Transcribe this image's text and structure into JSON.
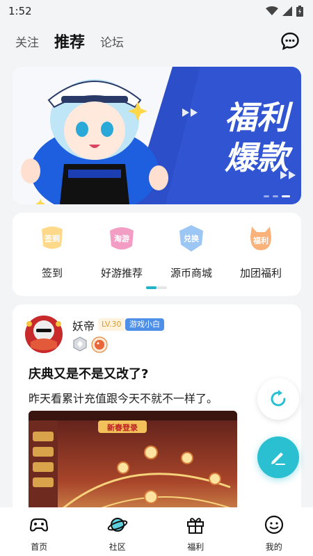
{
  "status": {
    "time": "1:52"
  },
  "top_tabs": [
    "关注",
    "推荐",
    "论坛"
  ],
  "banner": {
    "title_line1": "福利",
    "title_line2": "爆款"
  },
  "quick_links": [
    {
      "label": "签到",
      "badge": "签到"
    },
    {
      "label": "好游推荐",
      "badge": "淘游"
    },
    {
      "label": "源币商城",
      "badge": "兑换"
    },
    {
      "label": "加团福利",
      "badge": "福利"
    }
  ],
  "post": {
    "username": "妖帝",
    "level": "LV.30",
    "tag": "游戏小白",
    "title": "庆典又是不是又改了?",
    "body": "昨天看累计充值跟今天不就不一样了。",
    "image_caption": "新春登录"
  },
  "bottom_nav": [
    {
      "label": "首页",
      "icon": "gamepad-icon"
    },
    {
      "label": "社区",
      "icon": "planet-icon"
    },
    {
      "label": "福利",
      "icon": "gift-icon"
    },
    {
      "label": "我的",
      "icon": "smile-icon"
    }
  ],
  "colors": {
    "accent": "#2bbfd2",
    "banner_blue": "#2c4fc9",
    "level": "#d99a2b",
    "tag": "#4e8fe8"
  }
}
